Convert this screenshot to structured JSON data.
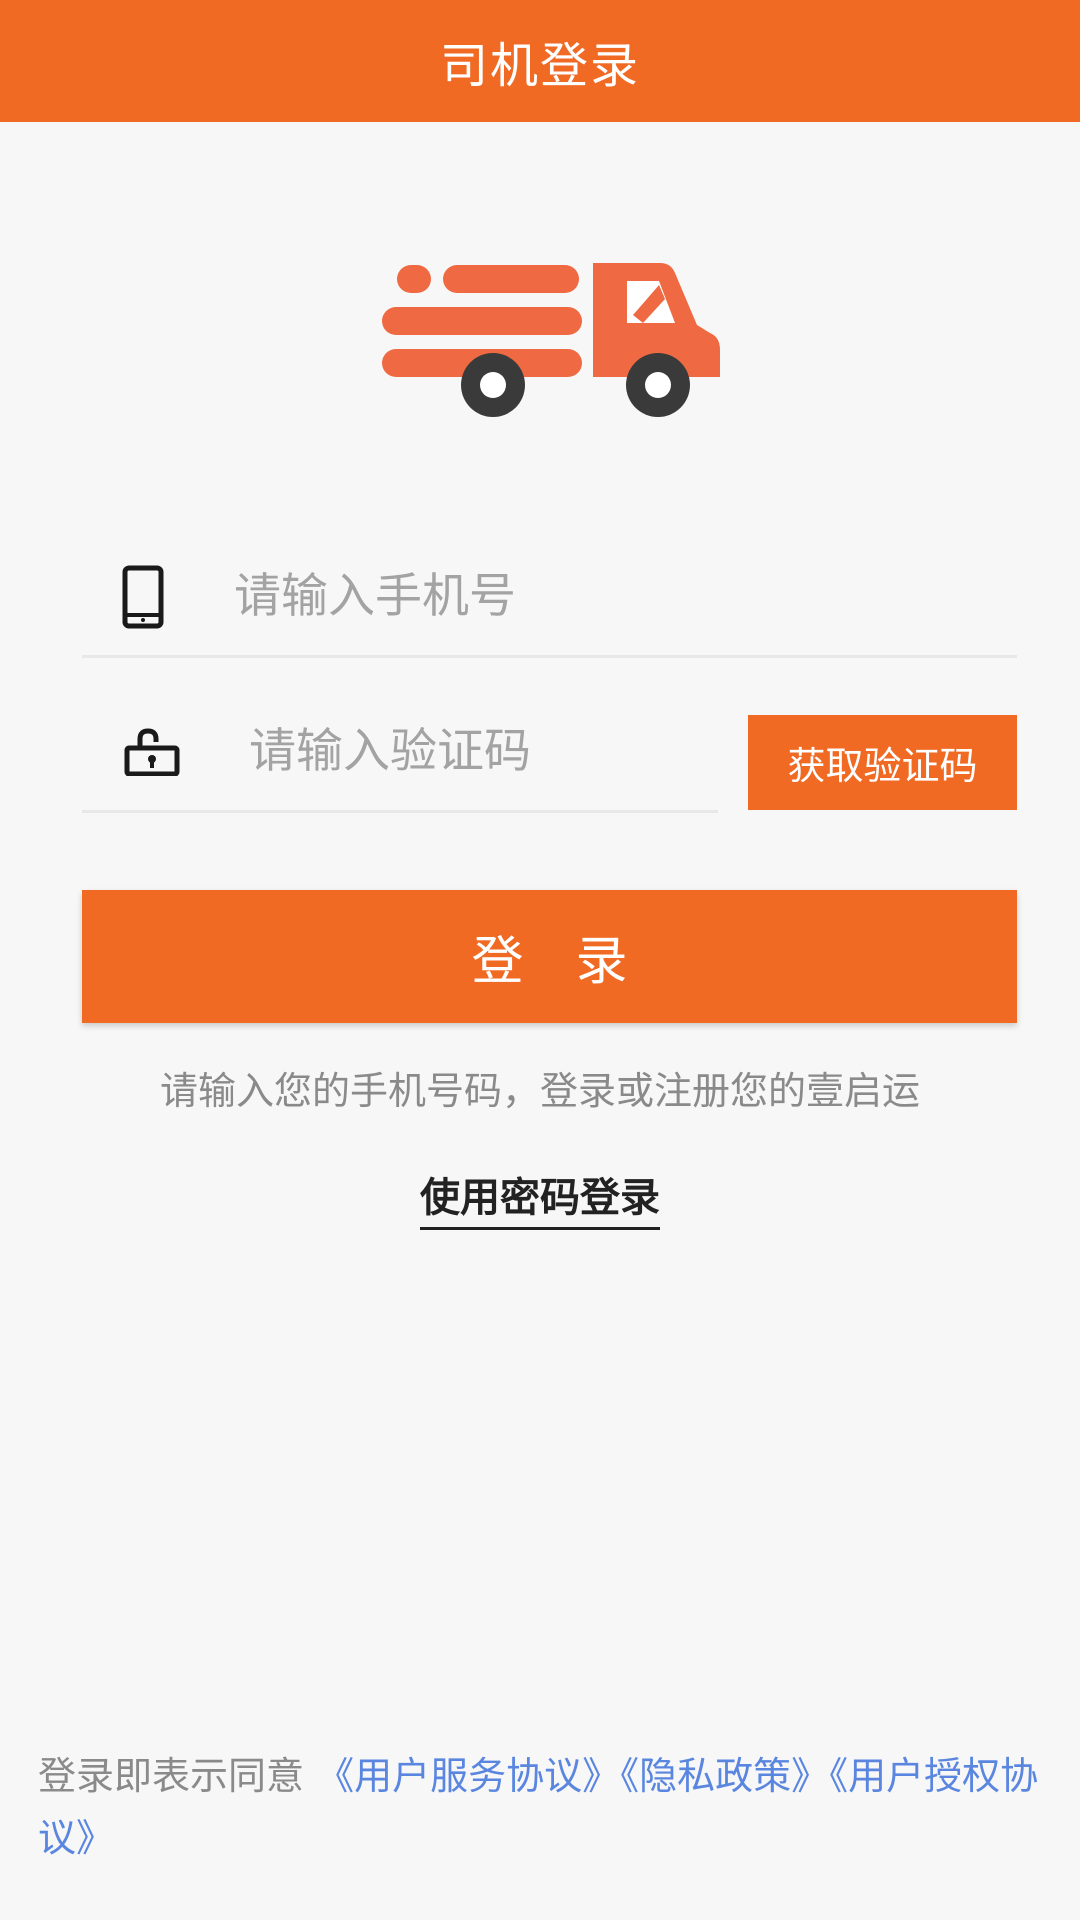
{
  "header": {
    "title": "司机登录"
  },
  "form": {
    "phone_placeholder": "请输入手机号",
    "code_placeholder": "请输入验证码",
    "get_code_label": "获取验证码",
    "login_label": "登　录"
  },
  "hint_text": "请输入您的手机号码，登录或注册您的壹启运",
  "password_login_label": "使用密码登录",
  "agreement": {
    "prefix": "登录即表示同意 ",
    "links": [
      "《用户服务协议》",
      "《隐私政策》",
      "《用户授权协议》"
    ]
  },
  "colors": {
    "accent": "#f06a24",
    "link": "#5a86e0"
  },
  "icons": {
    "logo": "truck-logo-icon",
    "phone": "phone-icon",
    "lock": "lock-icon"
  }
}
